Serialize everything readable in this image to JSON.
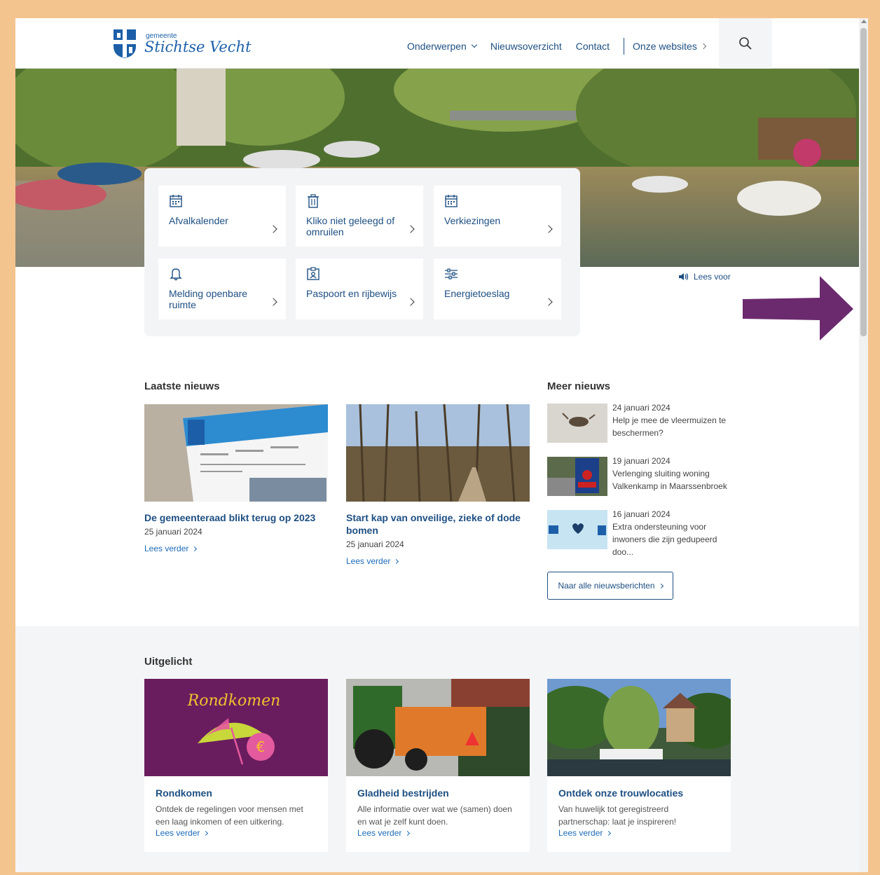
{
  "header": {
    "logo_small": "gemeente",
    "logo_big": "Stichtse Vecht",
    "nav": [
      {
        "label": "Onderwerpen"
      },
      {
        "label": "Nieuwsoverzicht"
      },
      {
        "label": "Contact"
      },
      {
        "label": "Onze websites"
      }
    ]
  },
  "hero": {
    "lees_voor": "Lees voor"
  },
  "tiles": [
    {
      "label": "Afvalkalender",
      "icon": "calendar-icon"
    },
    {
      "label": "Kliko niet geleegd of omruilen",
      "icon": "trash-icon"
    },
    {
      "label": "Verkiezingen",
      "icon": "calendar-icon"
    },
    {
      "label": "Melding openbare ruimte",
      "icon": "bell-icon"
    },
    {
      "label": "Paspoort en rijbewijs",
      "icon": "id-card-icon"
    },
    {
      "label": "Energietoeslag",
      "icon": "sliders-icon"
    }
  ],
  "news": {
    "title": "Laatste nieuws",
    "items": [
      {
        "title": "De gemeenteraad blikt terug op 2023",
        "date": "25 januari 2024",
        "more": "Lees verder"
      },
      {
        "title": "Start kap van onveilige, zieke of dode bomen",
        "date": "25 januari 2024",
        "more": "Lees verder"
      }
    ]
  },
  "meer": {
    "title": "Meer nieuws",
    "items": [
      {
        "date": "24 januari 2024",
        "title": "Help je mee de vleermuizen te beschermen?"
      },
      {
        "date": "19 januari 2024",
        "title": "Verlenging sluiting woning Valkenkamp in Maarssenbroek"
      },
      {
        "date": "16 januari 2024",
        "title": "Extra ondersteuning voor inwoners die zijn gedupeerd doo..."
      }
    ],
    "all_button": "Naar alle nieuwsberichten"
  },
  "uitgelicht": {
    "title": "Uitgelicht",
    "items": [
      {
        "title": "Rondkomen",
        "desc": "Ontdek de regelingen voor mensen met een laag inkomen of een uitkering.",
        "more": "Lees verder",
        "img_text": "Rondkomen"
      },
      {
        "title": "Gladheid bestrijden",
        "desc": "Alle informatie over wat we (samen) doen en wat je zelf kunt doen.",
        "more": "Lees verder"
      },
      {
        "title": "Ontdek onze trouwlocaties",
        "desc": "Van huwelijk tot geregistreerd partnerschap: laat je inspireren!",
        "more": "Lees verder"
      }
    ]
  },
  "colors": {
    "brand": "#1e4f82",
    "link": "#1c6bb8",
    "frame": "#f4c48e",
    "annotation_arrow": "#6b2a6e"
  }
}
